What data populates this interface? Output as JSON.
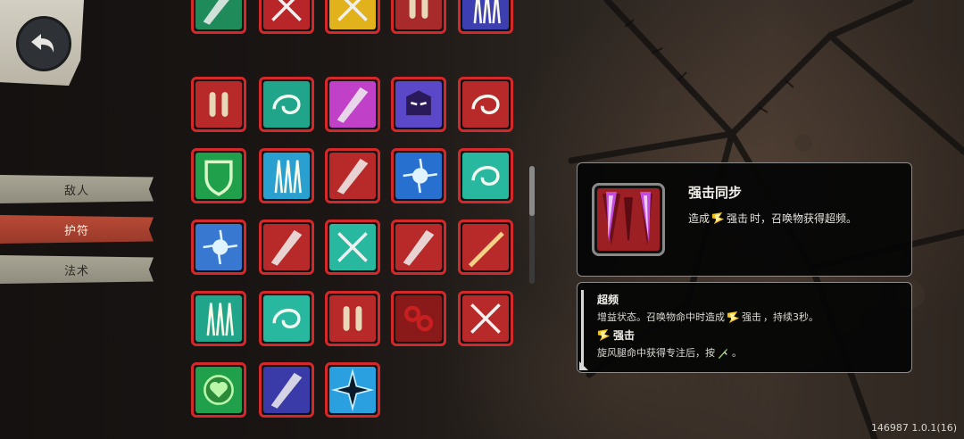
{
  "sidebar": {
    "tabs": [
      {
        "label": "敌人",
        "active": false
      },
      {
        "label": "护符",
        "active": true
      },
      {
        "label": "法术",
        "active": false
      }
    ]
  },
  "grid": {
    "border_color": "#d5282a",
    "items": [
      {
        "icon": "green-blade-icon",
        "bg": "#1f8a5a"
      },
      {
        "icon": "crossed-swords-icon",
        "bg": "#b8262a"
      },
      {
        "icon": "golden-daggers-icon",
        "bg": "#e2b21c"
      },
      {
        "icon": "ammo-cartridges-icon",
        "bg": "#a82a2a"
      },
      {
        "icon": "blue-spikes-icon",
        "bg": "#3d3fb0"
      },
      {
        "icon": "bullet-pair-icon",
        "bg": "#b82a2a"
      },
      {
        "icon": "teal-vortex-icon",
        "bg": "#20a58a"
      },
      {
        "icon": "purple-splash-icon",
        "bg": "#c040c8"
      },
      {
        "icon": "masked-ninja-icon",
        "bg": "#5a48c8"
      },
      {
        "icon": "red-swirl-icon",
        "bg": "#b82a2a"
      },
      {
        "icon": "green-shield-icon",
        "bg": "#20a04a"
      },
      {
        "icon": "yellow-arrows-icon",
        "bg": "#2aa0d0"
      },
      {
        "icon": "red-slash-icon",
        "bg": "#b82a2a"
      },
      {
        "icon": "blue-burst-icon",
        "bg": "#2870d0"
      },
      {
        "icon": "teal-wind-icon",
        "bg": "#28b8a0"
      },
      {
        "icon": "blue-impact-icon",
        "bg": "#3878d0"
      },
      {
        "icon": "axe-strike-icon",
        "bg": "#b82a2a"
      },
      {
        "icon": "teal-cross-slash-icon",
        "bg": "#28b8a0"
      },
      {
        "icon": "fist-bump-icon",
        "bg": "#b82a2a"
      },
      {
        "icon": "golden-beam-icon",
        "bg": "#b82a2a"
      },
      {
        "icon": "green-spears-icon",
        "bg": "#20a58a"
      },
      {
        "icon": "teal-gust-icon",
        "bg": "#28b8a0"
      },
      {
        "icon": "red-bullets-icon",
        "bg": "#b82a2a"
      },
      {
        "icon": "dark-knuckles-icon",
        "bg": "#8a1a1a"
      },
      {
        "icon": "crossed-knives-icon",
        "bg": "#b82a2a"
      },
      {
        "icon": "green-heart-icon",
        "bg": "#20a04a"
      },
      {
        "icon": "blue-bracket-icon",
        "bg": "#3a3aa8"
      },
      {
        "icon": "blue-star-icon",
        "bg": "#2aa0e0"
      }
    ]
  },
  "detail": {
    "title": "强击同步",
    "desc_prefix": "造成",
    "desc_keyword": "强击",
    "desc_suffix": "时，召唤物获得超频。",
    "icon": "strike-sync-icon"
  },
  "keywords": [
    {
      "title": "超频",
      "desc_prefix": "增益状态。召唤物命中时造成",
      "desc_keyword": "强击",
      "desc_suffix": "，持续3秒。"
    },
    {
      "title": "强击",
      "desc_prefix": "旋风腿命中获得专注后，按",
      "desc_suffix": "。",
      "title_icon": "strike-icon",
      "desc_icon": "dagger-icon"
    }
  ],
  "version": "146987 1.0.1(16)"
}
